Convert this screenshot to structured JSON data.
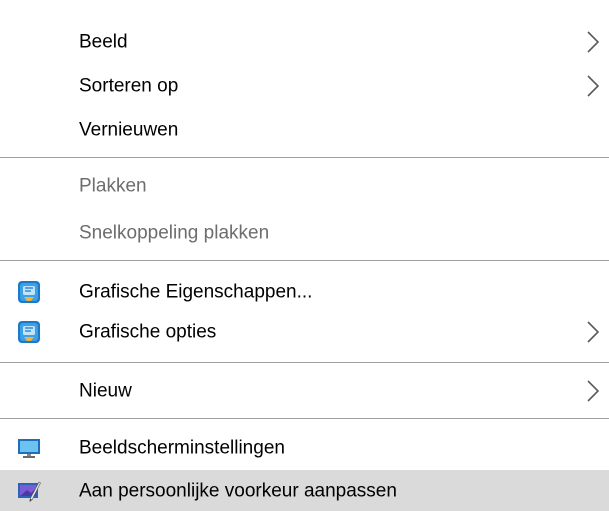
{
  "menu": {
    "items": [
      {
        "label": "Beeld"
      },
      {
        "label": "Sorteren op"
      },
      {
        "label": "Vernieuwen"
      },
      {
        "label": "Plakken"
      },
      {
        "label": "Snelkoppeling plakken"
      },
      {
        "label": "Grafische Eigenschappen...",
        "icon": "intel-graphics-icon"
      },
      {
        "label": "Grafische opties",
        "icon": "intel-graphics-icon"
      },
      {
        "label": "Nieuw"
      },
      {
        "label": "Beeldscherminstellingen",
        "icon": "monitor-icon"
      },
      {
        "label": "Aan persoonlijke voorkeur aanpassen",
        "icon": "personalize-icon"
      }
    ]
  },
  "colors": {
    "disabled_text": "#6d6d6d",
    "separator": "#a0a0a0",
    "hover_background": "#dadada",
    "chevron": "#5a5a5a"
  }
}
